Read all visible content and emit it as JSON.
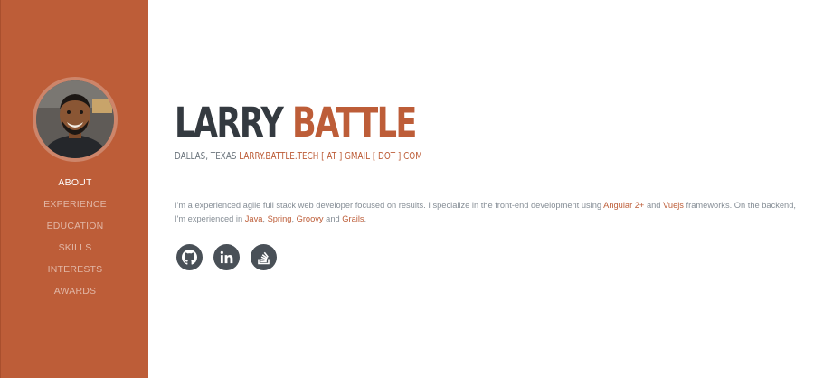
{
  "sidebar": {
    "nav": [
      "About",
      "Experience",
      "Education",
      "Skills",
      "Interests",
      "Awards"
    ]
  },
  "profile": {
    "first_name": "LARRY",
    "last_name": "BATTLE",
    "location": "DALLAS, TEXAS",
    "email_display": "LARRY.BATTLE.TECH [ AT ] GMAIL [ DOT ] COM"
  },
  "bio": {
    "part1": "I'm a experienced agile full stack web developer focused on results. I specialize in the front-end development using ",
    "angular": "Angular 2+",
    "and1": " and ",
    "vuejs": "Vuejs",
    "part2": " frameworks. On the backend, I'm experienced in ",
    "java": "Java",
    "comma1": ", ",
    "spring": "Spring",
    "comma2": ", ",
    "groovy": "Groovy",
    "and2": " and ",
    "grails": "Grails",
    "end": "."
  },
  "social": {
    "icons": [
      "github-icon",
      "linkedin-icon",
      "stackoverflow-icon"
    ]
  },
  "colors": {
    "accent": "#bd5d38",
    "heading": "#343a40",
    "muted": "#868e96",
    "social_bg": "#495057"
  }
}
